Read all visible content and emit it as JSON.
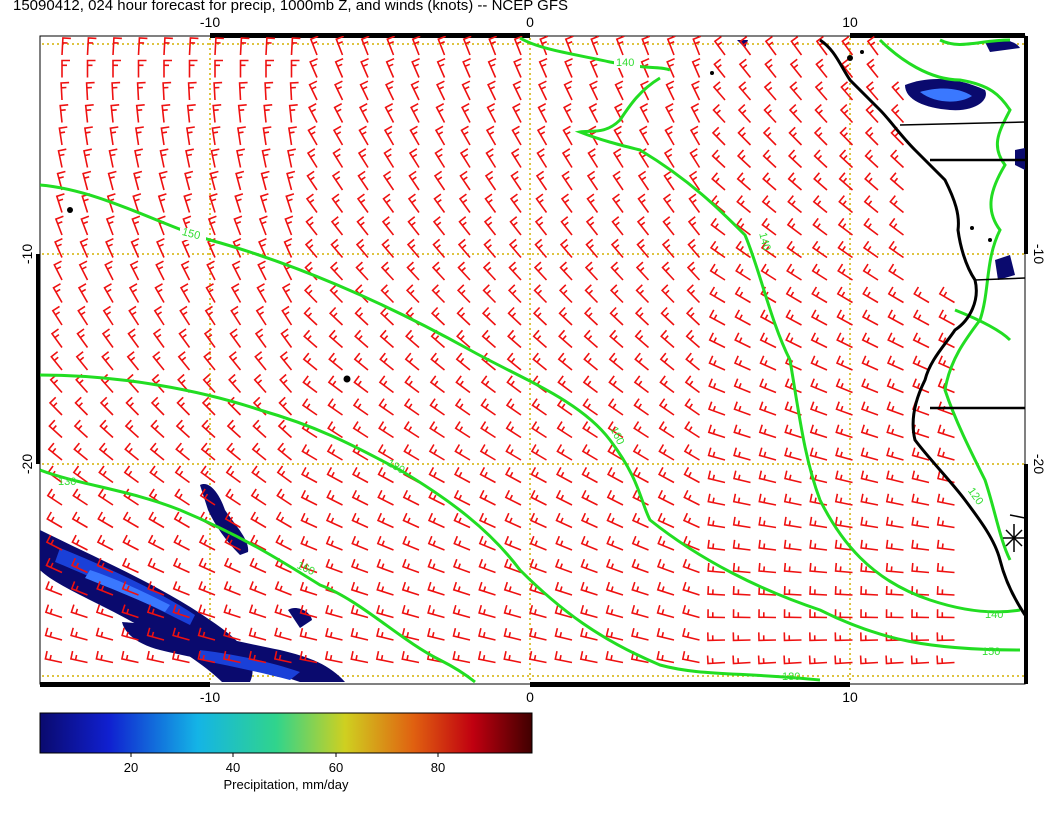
{
  "title": "15090412, 024 hour forecast for precip, 1000mb Z, and winds (knots) -- NCEP GFS",
  "axes": {
    "x_ticks_bottom": [
      "-10",
      "0",
      "10"
    ],
    "x_ticks_top": [
      "-10",
      "0",
      "10"
    ],
    "y_ticks_left": [
      "-10",
      "-20"
    ],
    "y_ticks_right": [
      "-10",
      "-20"
    ]
  },
  "contour_labels": [
    "140",
    "150",
    "140",
    "160",
    "180",
    "160",
    "130",
    "180",
    "120",
    "140",
    "150",
    "180"
  ],
  "colorbar": {
    "ticks": [
      "20",
      "40",
      "60",
      "80"
    ],
    "label": "Precipitation, mm/day",
    "colors": [
      "#0a0a6e",
      "#1020d0",
      "#14b4e6",
      "#30d48c",
      "#cfd020",
      "#e06010",
      "#c00010",
      "#400000"
    ]
  },
  "colors": {
    "wind_barbs": "#ee1111",
    "contours": "#22dd22",
    "gridlines": "#d4b000",
    "coastline": "#000000",
    "precip_core": "#3a78ff"
  }
}
